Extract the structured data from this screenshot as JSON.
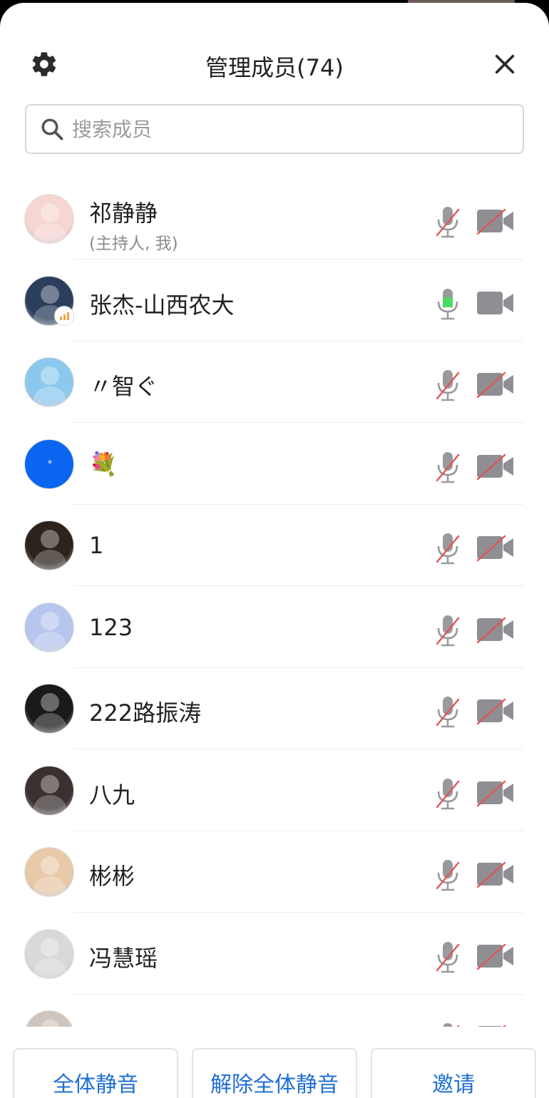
{
  "header": {
    "title": "管理成员(74)",
    "settings_icon": "gear-icon",
    "close_icon": "close-icon"
  },
  "search": {
    "placeholder": "搜索成员",
    "value": ""
  },
  "members": [
    {
      "name": "祁静静",
      "subtitle": "(主持人, 我)",
      "mic": "muted",
      "camera": "off",
      "avatar_color": "#f6d6d0",
      "avatar_icon": "girl-portrait-avatar"
    },
    {
      "name": "张杰-山西农大",
      "subtitle": "",
      "mic": "speaking",
      "camera": "on",
      "avatar_color": "#2b3e5c",
      "avatar_icon": "night-cat-avatar"
    },
    {
      "name": "〃智ぐ",
      "subtitle": "",
      "mic": "muted",
      "camera": "off",
      "avatar_color": "#8cc8ee",
      "avatar_icon": "sky-figure-avatar"
    },
    {
      "name": "💐",
      "subtitle": "",
      "mic": "muted",
      "camera": "off",
      "avatar_color": "#0a66f0",
      "avatar_icon": "blue-dot-avatar"
    },
    {
      "name": "1",
      "subtitle": "",
      "mic": "muted",
      "camera": "off",
      "avatar_color": "#2c231c",
      "avatar_icon": "dark-candle-avatar"
    },
    {
      "name": "123",
      "subtitle": "",
      "mic": "muted",
      "camera": "off",
      "avatar_color": "#b7c6ee",
      "avatar_icon": "anime-boy-avatar"
    },
    {
      "name": "222路振涛",
      "subtitle": "",
      "mic": "muted",
      "camera": "off",
      "avatar_color": "#1a1a1a",
      "avatar_icon": "masked-avatar"
    },
    {
      "name": "八九",
      "subtitle": "",
      "mic": "muted",
      "camera": "off",
      "avatar_color": "#3a3030",
      "avatar_icon": "girl-dark-hair-avatar"
    },
    {
      "name": "彬彬",
      "subtitle": "",
      "mic": "muted",
      "camera": "off",
      "avatar_color": "#e8c9a8",
      "avatar_icon": "cartoon-girl-avatar"
    },
    {
      "name": "冯慧瑶",
      "subtitle": "",
      "mic": "muted",
      "camera": "off",
      "avatar_color": "#d9d9d9",
      "avatar_icon": "girl-photo-avatar"
    },
    {
      "name": "",
      "subtitle": "",
      "mic": "muted",
      "camera": "off",
      "avatar_color": "#cfc5bd",
      "avatar_icon": "partial-avatar"
    }
  ],
  "footer": {
    "mute_all": "全体静音",
    "unmute_all": "解除全体静音",
    "invite": "邀请"
  },
  "colors": {
    "accent_blue": "#1f6fd6",
    "mic_active_green": "#4cd964",
    "muted_slash_red": "#e05555",
    "icon_gray": "#8e8e93"
  }
}
